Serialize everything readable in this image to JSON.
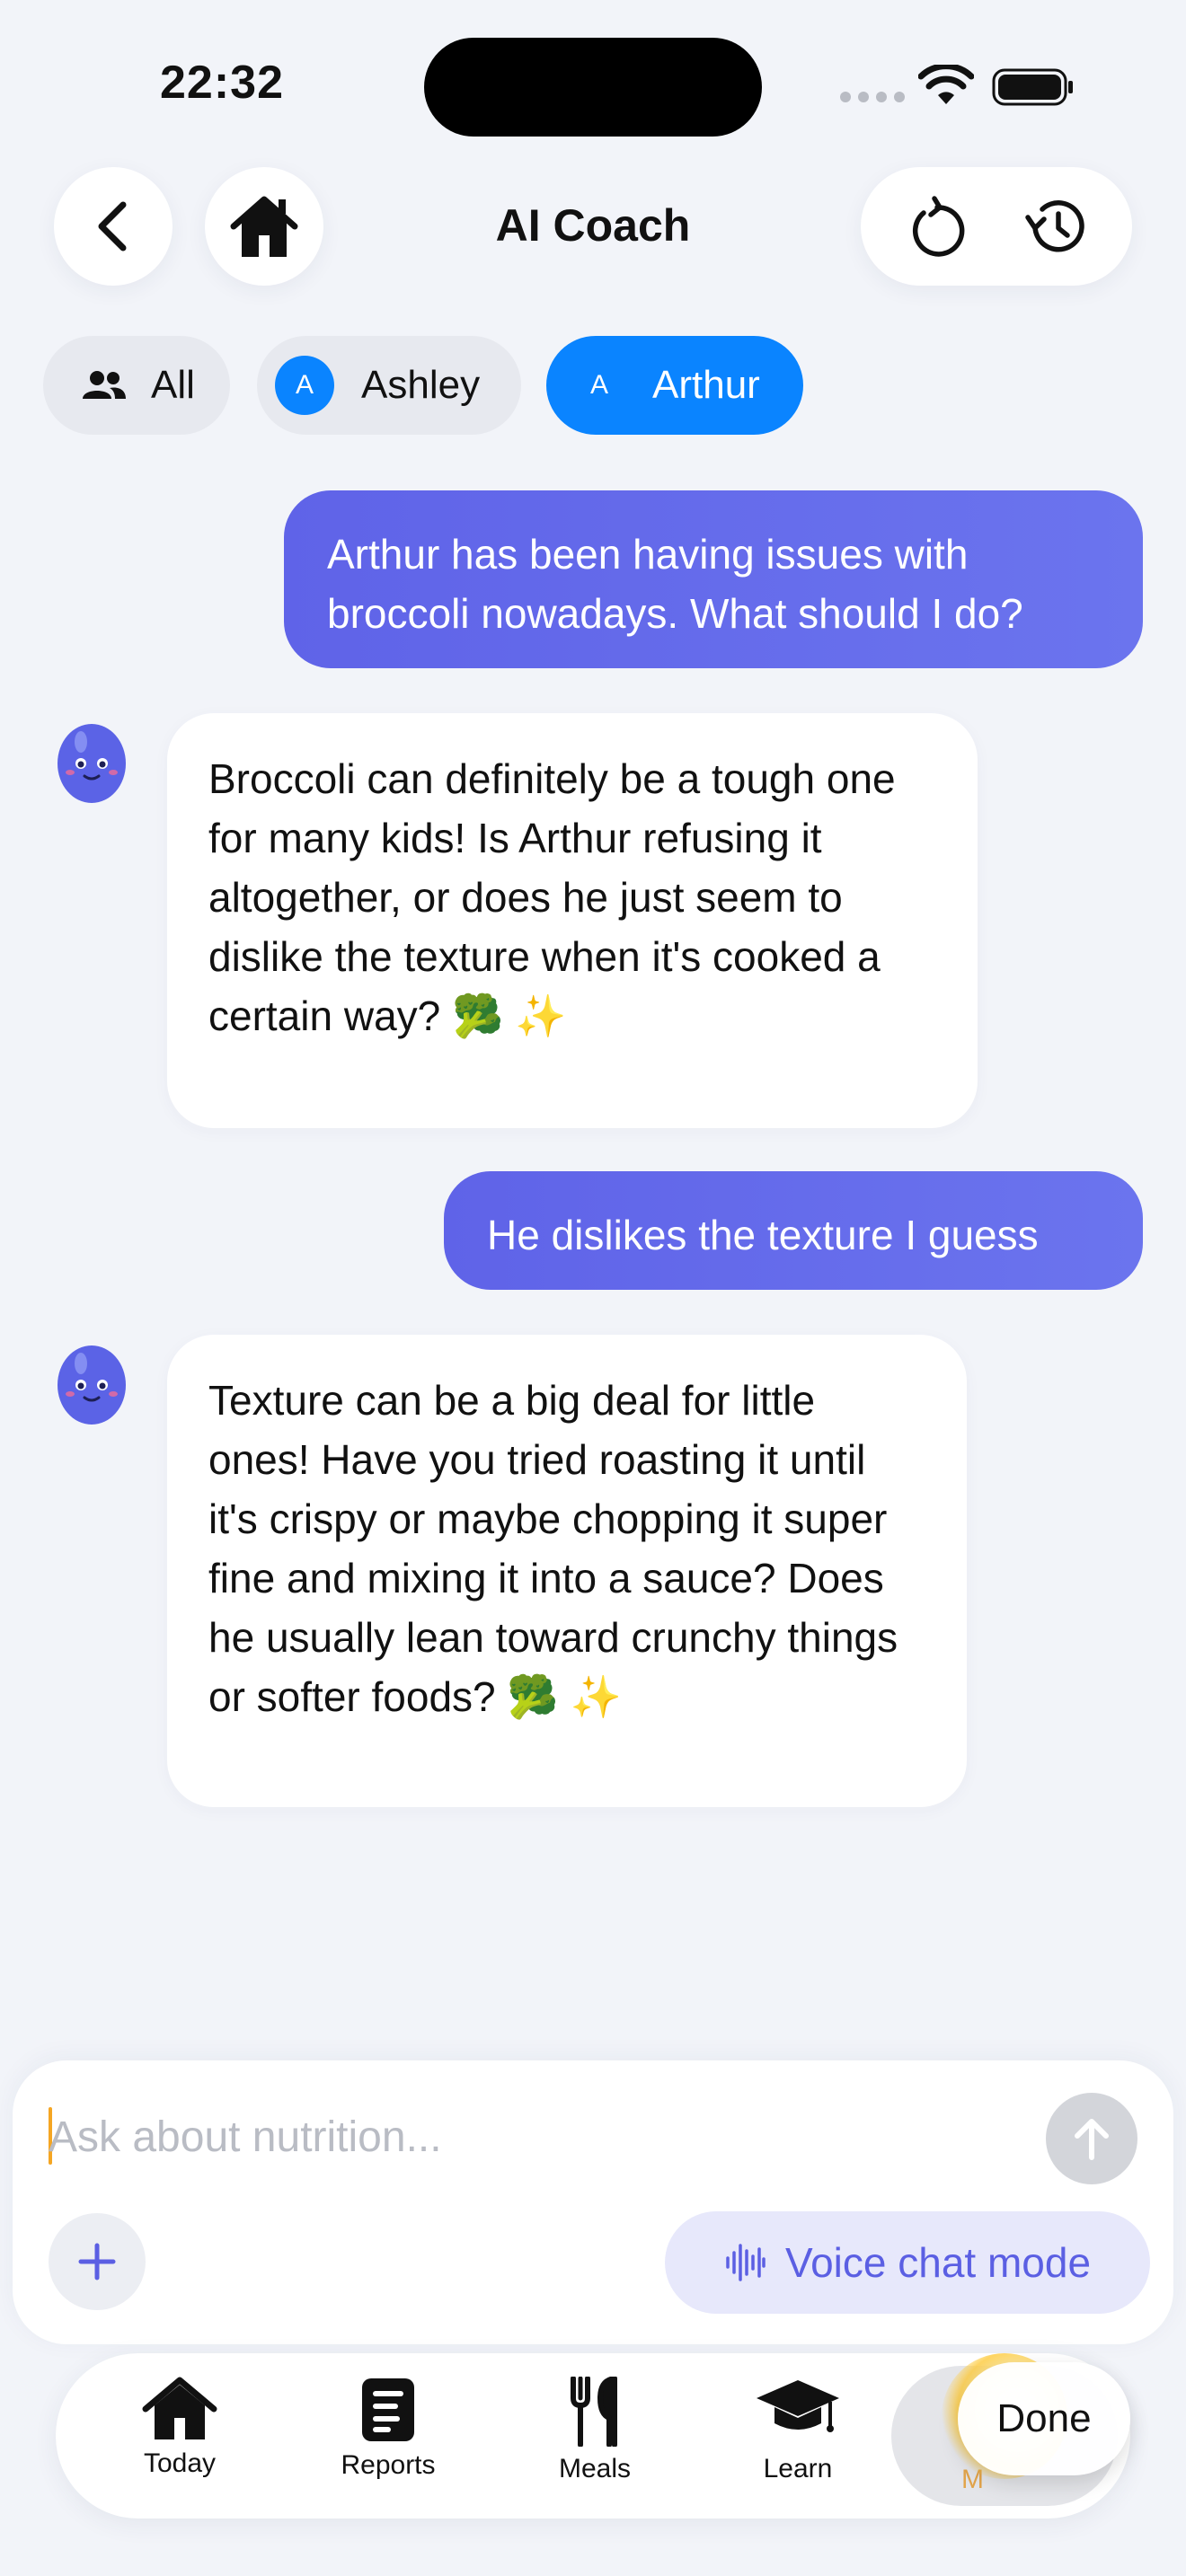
{
  "status_bar": {
    "time": "22:32"
  },
  "header": {
    "title": "AI Coach"
  },
  "filters": {
    "all_label": "All",
    "ashley_label": "Ashley",
    "ashley_initial": "A",
    "arthur_label": "Arthur",
    "arthur_initial": "A",
    "selected": "Arthur"
  },
  "messages": [
    {
      "role": "user",
      "text": "Arthur has been having issues with broccoli nowadays. What should I do?"
    },
    {
      "role": "assistant",
      "text": "Broccoli can definitely be a tough one for many kids! Is Arthur refusing it altogether, or does he just seem to dislike the texture when it's cooked a certain way? 🥦 ✨"
    },
    {
      "role": "user",
      "text": "He dislikes the texture I guess"
    },
    {
      "role": "assistant",
      "text": "Texture can be a big deal for little ones! Have you tried roasting it until it's crispy or maybe chopping it super fine and mixing it into a sauce? Does he usually lean toward crunchy things or softer foods? 🥦 ✨"
    }
  ],
  "composer": {
    "placeholder": "Ask about nutrition...",
    "value": "",
    "voice_label": "Voice chat mode"
  },
  "tabbar": {
    "today": "Today",
    "reports": "Reports",
    "meals": "Meals",
    "learn": "Learn",
    "more_partial": "M",
    "done": "Done"
  },
  "colors": {
    "accent_blue": "#0a84ff",
    "user_bubble": "#6167e9",
    "voice_text": "#5b5fe3",
    "background": "#f2f4f9"
  },
  "icons": [
    "back-icon",
    "home-icon",
    "refresh-icon",
    "history-icon",
    "people-icon",
    "send-arrow-icon",
    "plus-icon",
    "waveform-icon",
    "house-tab-icon",
    "report-icon",
    "fork-knife-icon",
    "graduation-cap-icon"
  ]
}
